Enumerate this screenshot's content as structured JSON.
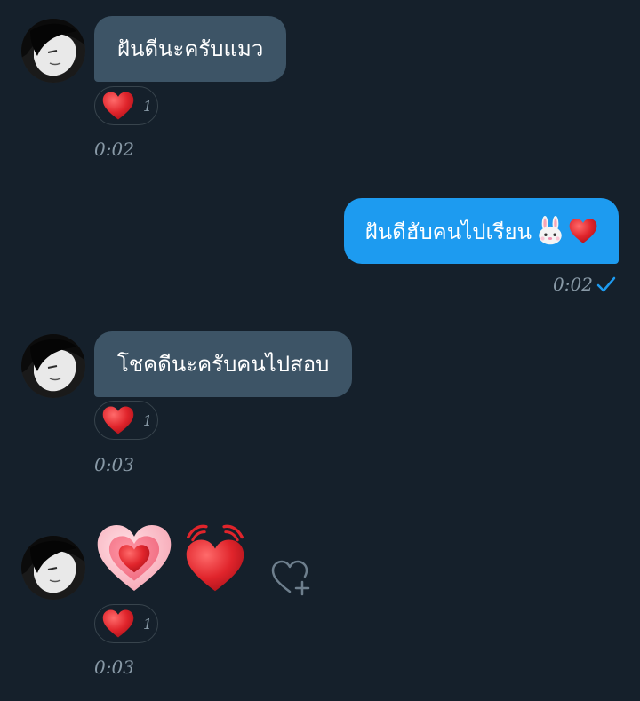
{
  "colors": {
    "background": "#15202b",
    "incoming_bubble": "#3d5466",
    "outgoing_bubble": "#1d9bf0",
    "meta_text": "#8899a6",
    "heart_red": "#e0242b"
  },
  "messages": [
    {
      "direction": "incoming",
      "text": "ฝันดีนะครับแมว",
      "reaction": {
        "icon": "red-heart-icon",
        "count": "1"
      },
      "time": "0:02"
    },
    {
      "direction": "outgoing",
      "text": "ฝันดีฮับคนไปเรียน",
      "trailing_emoji": [
        "rabbit-face-icon",
        "red-heart-icon"
      ],
      "time": "0:02",
      "status_icon": "sent-check-icon"
    },
    {
      "direction": "incoming",
      "text": "โชคดีนะครับคนไปสอบ",
      "reaction": {
        "icon": "red-heart-icon",
        "count": "1"
      },
      "time": "0:03"
    },
    {
      "direction": "incoming",
      "emoji_only": [
        "growing-heart-icon",
        "beating-heart-icon"
      ],
      "reaction": {
        "icon": "red-heart-icon",
        "count": "1"
      },
      "time": "0:03",
      "add_reaction_icon": "heart-plus-icon"
    }
  ]
}
